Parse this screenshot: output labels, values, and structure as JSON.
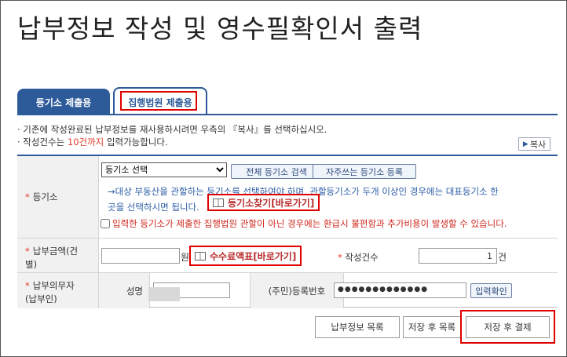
{
  "page_title": "납부정보 작성 및 영수필확인서 출력",
  "tabs": [
    {
      "label": "등기소 제출용",
      "active": false
    },
    {
      "label": "집행법원 제출용",
      "active": true
    }
  ],
  "notice": {
    "line1": "· 기존에 작성완료된 납부정보를 재사용하시려면 우측의 『복사』를 선택하십시오.",
    "line2_prefix": "· 작성건수는 ",
    "line2_highlight": "10건까지",
    "line2_suffix": " 입력가능합니다."
  },
  "copy_button": "복사",
  "registry": {
    "label": "등기소",
    "select_value": "등기소 선택",
    "search_all": "전체 등기소 검색",
    "register_frequent": "자주쓰는 등기소 등록",
    "info_line1": "→대상 부동산을 관할하는 등기소를 선택하여야 하며, 관할등기소가 두개 이상인 경우에는 대표등기소 한",
    "info_line2": "곳을 선택하시면 됩니다.",
    "find_link": "등기소찾기[바로가기]",
    "warning": "입력한 등기소가 제출한 집행법원 관할이 아닌 경우에는 환급시 불편함과 추가비용이 발생할 수 있습니다."
  },
  "payment": {
    "label_line1": "납부금액(건",
    "label_line2": "별)",
    "amount_value": "",
    "currency_unit": "원",
    "fee_link": "수수료액표[바로가기]",
    "count_label": "작성건수",
    "count_value": "1",
    "count_unit": "건"
  },
  "payer": {
    "label_line1": "납부의무자",
    "label_line2": "(납부인)",
    "name_label": "성명",
    "reg_label": "(주민)등록번호",
    "reg_value": "●●●●●●●●●●●●●",
    "confirm_button": "입력확인"
  },
  "bottom_buttons": {
    "list": "납부정보 목록",
    "save_list": "저장 후 목록",
    "save_pay": "저장 후 결제"
  },
  "colors": {
    "accent": "#2d5a99",
    "highlight_box": "#e00000",
    "info_text": "#2e5ea8",
    "warning_text": "#d0281f"
  }
}
